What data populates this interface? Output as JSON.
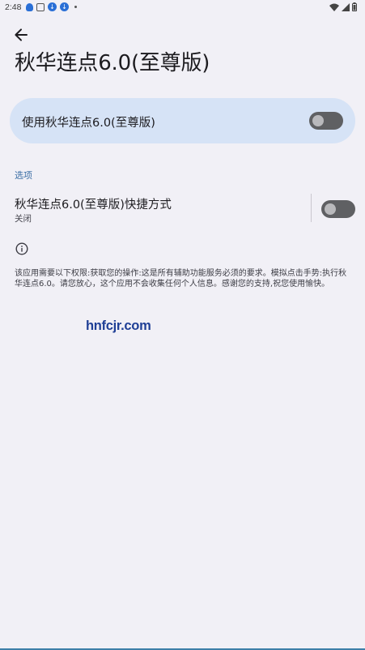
{
  "status_bar": {
    "time": "2:48"
  },
  "header": {
    "title": "秋华连点6.0(至尊版)"
  },
  "main_switch": {
    "label": "使用秋华连点6.0(至尊版)",
    "on": false
  },
  "options": {
    "header": "选项",
    "shortcut": {
      "title": "秋华连点6.0(至尊版)快捷方式",
      "summary": "关闭",
      "on": false
    }
  },
  "info": {
    "text": "该应用需要以下权限:获取您的操作:这是所有辅助功能服务必须的要求。模拟点击手势:执行秋华连点6.0。请您放心，这个应用不会收集任何个人信息。感谢您的支持,祝您使用愉快。"
  },
  "watermark": "hnfcjr.com",
  "colors": {
    "background": "#f1f0f6",
    "card": "#d6e3f6",
    "accent_text": "#3b6ea5",
    "switch_track": "#5f6063",
    "watermark": "#1f3f96"
  }
}
